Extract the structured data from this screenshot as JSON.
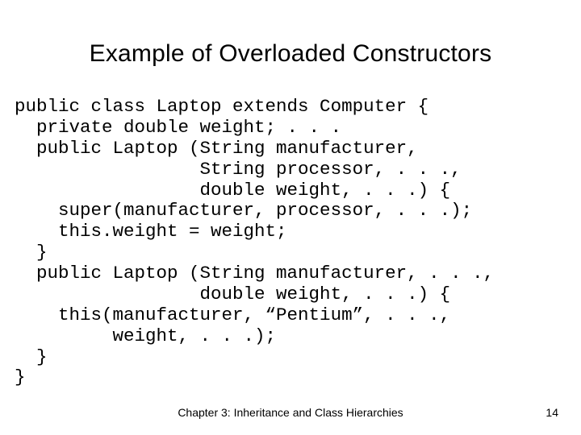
{
  "slide": {
    "title": "Example of Overloaded Constructors",
    "code": "public class Laptop extends Computer {\n  private double weight; . . .\n  public Laptop (String manufacturer,\n                 String processor, . . .,\n                 double weight, . . .) {\n    super(manufacturer, processor, . . .);\n    this.weight = weight;\n  }\n  public Laptop (String manufacturer, . . .,\n                 double weight, . . .) {\n    this(manufacturer, “Pentium”, . . .,\n         weight, . . .);\n  }\n}",
    "footer": "Chapter 3: Inheritance and Class Hierarchies",
    "page_number": "14"
  }
}
